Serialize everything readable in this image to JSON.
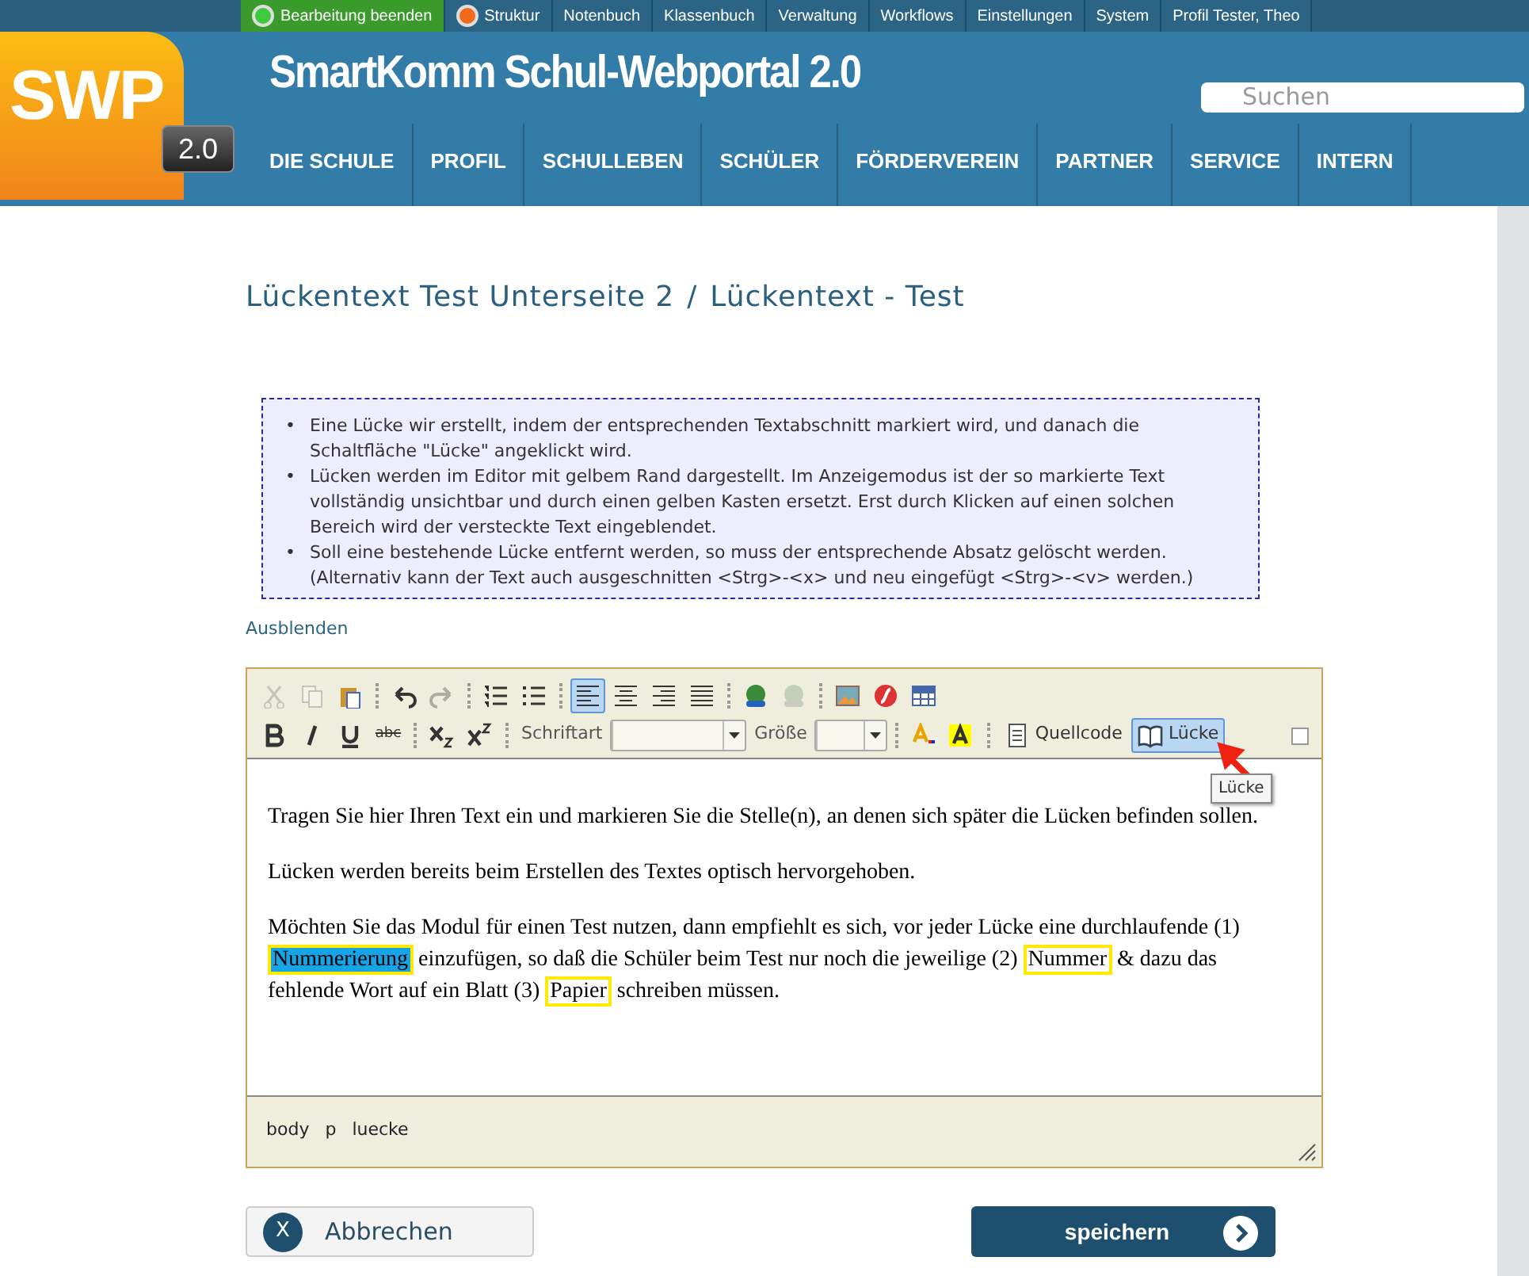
{
  "admin_bar": [
    {
      "label": "Bearbeitung beenden",
      "kind": "edit"
    },
    {
      "label": "Struktur",
      "kind": "structure"
    },
    {
      "label": "Notenbuch",
      "kind": "link"
    },
    {
      "label": "Klassenbuch",
      "kind": "link"
    },
    {
      "label": "Verwaltung",
      "kind": "link"
    },
    {
      "label": "Workflows",
      "kind": "link"
    },
    {
      "label": "Einstellungen",
      "kind": "link"
    },
    {
      "label": "System",
      "kind": "link"
    },
    {
      "label": "Profil Tester, Theo",
      "kind": "link"
    }
  ],
  "logo": {
    "text": "SWP",
    "version": "2.0"
  },
  "site_title": "SmartKomm Schul-Webportal 2.0",
  "search": {
    "placeholder": "Suchen"
  },
  "main_nav": [
    "DIE SCHULE",
    "PROFIL",
    "SCHULLEBEN",
    "SCHÜLER",
    "FÖRDERVEREIN",
    "PARTNER",
    "SERVICE",
    "INTERN"
  ],
  "breadcrumb": {
    "parts": [
      "Lückentext Test Unterseite 2",
      "Lückentext - Test"
    ],
    "separator": "/"
  },
  "info_box": {
    "marker": "•",
    "items": [
      "Eine Lücke wir erstellt, indem der entsprechenden Textabschnitt markiert wird, und danach die Schaltfläche \"Lücke\" angeklickt wird.",
      "Lücken werden im Editor mit gelbem Rand dargestellt. Im Anzeigemodus ist der so markierte Text vollständig unsichtbar und durch einen gelben Kasten ersetzt. Erst durch Klicken auf einen solchen Bereich wird der versteckte Text eingeblendet.",
      "Soll eine bestehende Lücke entfernt werden, so muss der entsprechende Absatz gelöscht werden. (Alternativ kann der Text auch ausgeschnitten <Strg>-<x> und neu eingefügt <Strg>-<v> werden.)"
    ]
  },
  "hide_link": "Ausblenden",
  "toolbar": {
    "row_1": [
      {
        "kind": "cut",
        "disabled": true,
        "selected": false
      },
      {
        "kind": "copy",
        "disabled": true,
        "selected": false
      },
      {
        "kind": "paste",
        "disabled": false,
        "selected": false
      },
      {
        "kind": "separator"
      },
      {
        "kind": "undo",
        "disabled": false,
        "selected": false
      },
      {
        "kind": "redo",
        "disabled": true,
        "selected": false
      },
      {
        "kind": "separator"
      },
      {
        "kind": "numbered",
        "disabled": false,
        "selected": false
      },
      {
        "kind": "bullets",
        "disabled": false,
        "selected": false
      },
      {
        "kind": "separator"
      },
      {
        "kind": "left",
        "disabled": false,
        "selected": true
      },
      {
        "kind": "center",
        "disabled": false,
        "selected": false
      },
      {
        "kind": "right",
        "disabled": false,
        "selected": false
      },
      {
        "kind": "justify",
        "disabled": false,
        "selected": false
      },
      {
        "kind": "separator"
      },
      {
        "kind": "link",
        "disabled": false,
        "selected": false
      },
      {
        "kind": "unlink",
        "disabled": true,
        "selected": false
      },
      {
        "kind": "separator"
      },
      {
        "kind": "image",
        "disabled": false,
        "selected": false
      },
      {
        "kind": "flash",
        "disabled": false,
        "selected": false
      },
      {
        "kind": "table",
        "disabled": false,
        "selected": false
      }
    ],
    "row_2": [
      {
        "kind": "bold",
        "disabled": false,
        "selected": false
      },
      {
        "kind": "italic",
        "disabled": false,
        "selected": false
      },
      {
        "kind": "underline",
        "disabled": false,
        "selected": false
      },
      {
        "kind": "strike",
        "label": "abc",
        "disabled": false,
        "selected": false
      },
      {
        "kind": "separator"
      },
      {
        "kind": "subscript",
        "disabled": false,
        "selected": false
      },
      {
        "kind": "superscript",
        "disabled": false,
        "selected": false
      },
      {
        "kind": "separator"
      },
      {
        "kind": "font",
        "label": "Schriftart"
      },
      {
        "kind": "size",
        "label": "Größe"
      },
      {
        "kind": "separator"
      },
      {
        "kind": "textcolor",
        "disabled": false,
        "selected": false
      },
      {
        "kind": "bgcolor",
        "disabled": false,
        "selected": false
      },
      {
        "kind": "separator"
      },
      {
        "kind": "source",
        "label": "Quellcode",
        "disabled": false,
        "selected": false
      },
      {
        "kind": "gap",
        "label": "Lücke",
        "disabled": false,
        "selected": true
      }
    ],
    "tooltip": "Lücke"
  },
  "content": [
    [
      {
        "text": "Tragen Sie hier Ihren Text ein und markieren Sie die Stelle(n), an denen sich später die Lücken befinden sollen.",
        "kind": "plain"
      }
    ],
    [
      {
        "text": "Lücken werden bereits beim Erstellen des Textes optisch hervorgehoben.",
        "kind": "plain"
      }
    ],
    [
      {
        "text": "Möchten Sie das Modul für einen Test nutzen, dann empfiehlt es sich, vor jeder Lücke eine durchlaufende (1) ",
        "kind": "plain"
      },
      {
        "text": "Nummerierung",
        "kind": "gap",
        "selected": true
      },
      {
        "text": " einzufügen, so daß die Schüler beim Test nur noch die jeweilige (2) ",
        "kind": "plain"
      },
      {
        "text": "Nummer",
        "kind": "gap",
        "selected": false
      },
      {
        "text": " & dazu das fehlende Wort auf ein Blatt (3) ",
        "kind": "plain"
      },
      {
        "text": "Papier",
        "kind": "gap",
        "selected": false
      },
      {
        "text": " schreiben müssen.",
        "kind": "plain"
      }
    ]
  ],
  "element_path": [
    "body",
    "p",
    "luecke"
  ],
  "buttons": {
    "cancel": {
      "icon_text": "X",
      "label": "Abbrechen"
    },
    "save": {
      "label": "speichern"
    }
  }
}
